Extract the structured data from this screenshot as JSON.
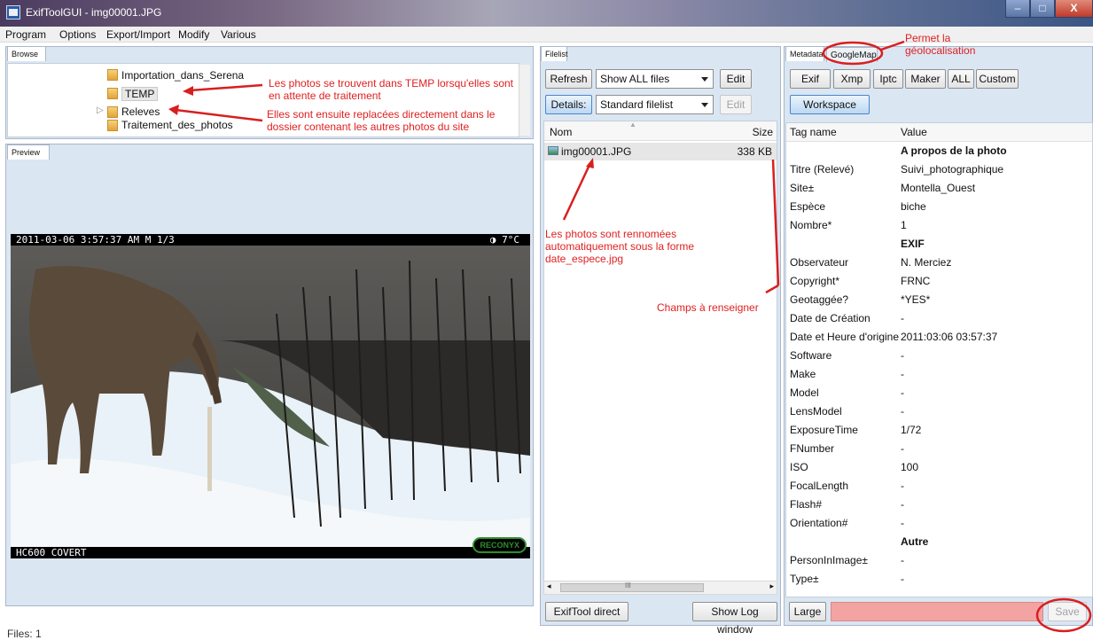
{
  "window": {
    "title": "ExifToolGUI - img00001.JPG",
    "min": "–",
    "max": "□",
    "close": "X"
  },
  "menu": [
    "Program",
    "Options",
    "Export/Import",
    "Modify",
    "Various"
  ],
  "browse": {
    "tab": "Browse",
    "folders": [
      "Importation_dans_Serena",
      "TEMP",
      "Releves",
      "Traitement_des_photos"
    ],
    "expander": "▷"
  },
  "preview": {
    "tab": "Preview",
    "overlay_top": "2011-03-06 3:57:37 AM   M 1/3",
    "overlay_top_right": "◑    7°C",
    "overlay_bottom": "HC600 COVERT",
    "brand": "RECONYX"
  },
  "filelist": {
    "tab": "Filelist",
    "refresh": "Refresh",
    "filter": "Show ALL files",
    "edit": "Edit",
    "details": "Details:",
    "view": "Standard filelist",
    "edit2": "Edit",
    "col_name": "Nom",
    "col_size": "Size",
    "file_name": "img00001.JPG",
    "file_size": "338 KB",
    "scroll_mark": "III",
    "exiftool_direct": "ExifTool direct",
    "show_log": "Show Log window"
  },
  "metadata": {
    "tab_metadata": "Metadata",
    "tab_googlemap": "GoogleMap",
    "buttons": [
      "Exif",
      "Xmp",
      "Iptc",
      "Maker",
      "ALL",
      "Custom"
    ],
    "workspace": "Workspace",
    "col_tag": "Tag name",
    "col_value": "Value",
    "rows": [
      {
        "k": "",
        "v": "A propos de la photo",
        "section": true
      },
      {
        "k": "Titre (Relevé)",
        "v": "Suivi_photographique"
      },
      {
        "k": "Site±",
        "v": "Montella_Ouest"
      },
      {
        "k": "Espèce",
        "v": "biche"
      },
      {
        "k": "Nombre*",
        "v": "1"
      },
      {
        "k": "",
        "v": "EXIF",
        "section": true
      },
      {
        "k": "Observateur",
        "v": "N. Merciez"
      },
      {
        "k": "Copyright*",
        "v": "FRNC"
      },
      {
        "k": "Geotaggée?",
        "v": "*YES*"
      },
      {
        "k": "Date de Création",
        "v": "-"
      },
      {
        "k": "Date et Heure d'origine",
        "v": "2011:03:06 03:57:37"
      },
      {
        "k": "Software",
        "v": "-"
      },
      {
        "k": "Make",
        "v": "-"
      },
      {
        "k": "Model",
        "v": "-"
      },
      {
        "k": "LensModel",
        "v": "-"
      },
      {
        "k": "ExposureTime",
        "v": "1/72"
      },
      {
        "k": "FNumber",
        "v": "-"
      },
      {
        "k": "ISO",
        "v": "100"
      },
      {
        "k": "FocalLength",
        "v": "-"
      },
      {
        "k": "Flash#",
        "v": "-"
      },
      {
        "k": "Orientation#",
        "v": "-"
      },
      {
        "k": "",
        "v": "Autre",
        "section": true
      },
      {
        "k": "PersonInImage±",
        "v": "-"
      },
      {
        "k": "Type±",
        "v": "-"
      }
    ],
    "large": "Large",
    "save": "Save"
  },
  "annotations": {
    "temp_note": "Les photos se trouvent dans TEMP lorsqu'elles sont en attente de traitement",
    "moved_note": "Elles sont ensuite replacées directement dans le dossier contenant les autres photos du site",
    "rename_note": "Les photos sont rennomées automatiquement sous la forme date_espece.jpg",
    "fields_note": "Champs à renseigner",
    "geo_note": "Permet la géolocalisation"
  },
  "status": "Files: 1"
}
